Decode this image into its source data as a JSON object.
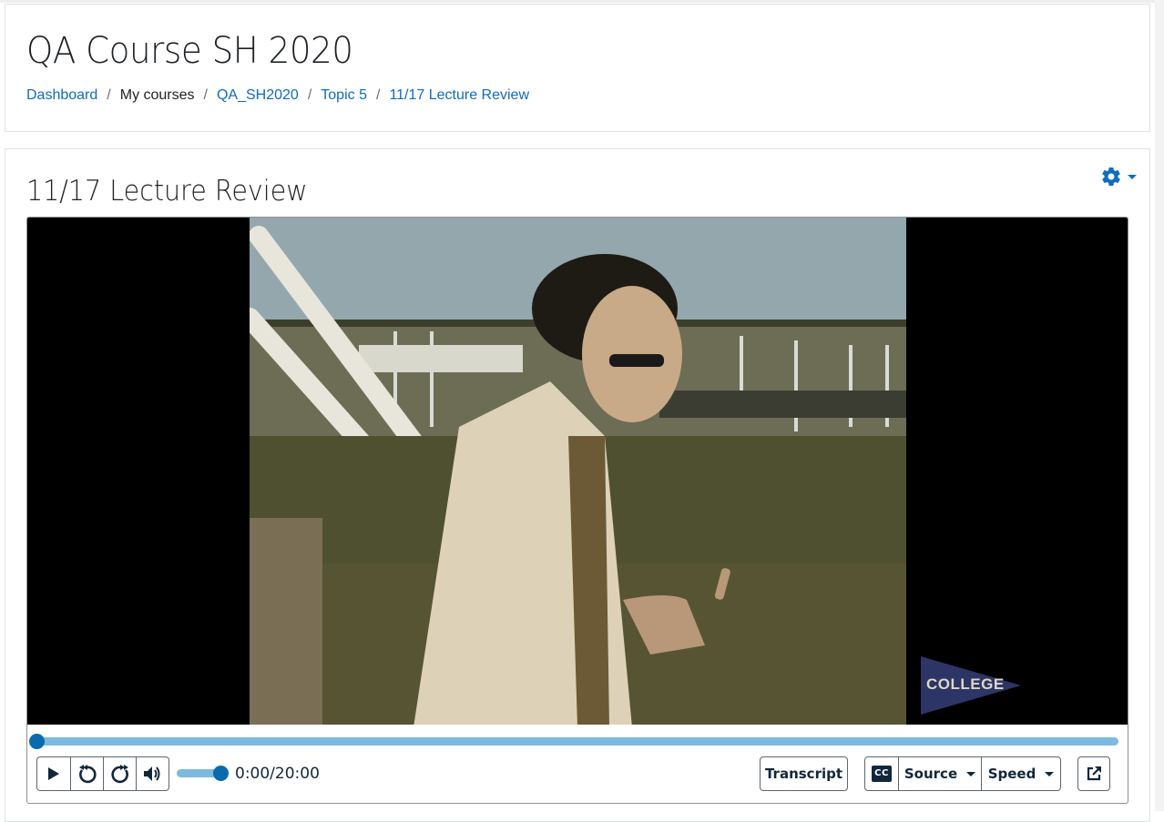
{
  "header": {
    "course_title": "QA Course SH 2020",
    "breadcrumb": [
      {
        "label": "Dashboard",
        "link": true
      },
      {
        "label": "My courses",
        "link": false
      },
      {
        "label": "QA_SH2020",
        "link": true
      },
      {
        "label": "Topic 5",
        "link": true
      },
      {
        "label": "11/17 Lecture Review",
        "link": true
      }
    ],
    "separator": "/"
  },
  "activity": {
    "title": "11/17 Lecture Review",
    "settings_icon": "gear-icon"
  },
  "player": {
    "video_watermark": "COLLEGE",
    "progress_fraction": 0.0,
    "volume_fraction": 1.0,
    "time_display": "0:00/20:00",
    "buttons": {
      "play": "play-icon",
      "rewind": "rewind-icon",
      "forward": "forward-icon",
      "volume": "volume-icon",
      "transcript": "Transcript",
      "cc": "CC",
      "source": "Source",
      "speed": "Speed",
      "popout": "external-link-icon"
    }
  },
  "colors": {
    "link": "#0f6cbf",
    "progress_track": "#7cbadf",
    "progress_knob": "#0a6aad",
    "control_text": "#12273a",
    "pennant": "#2d3566"
  }
}
